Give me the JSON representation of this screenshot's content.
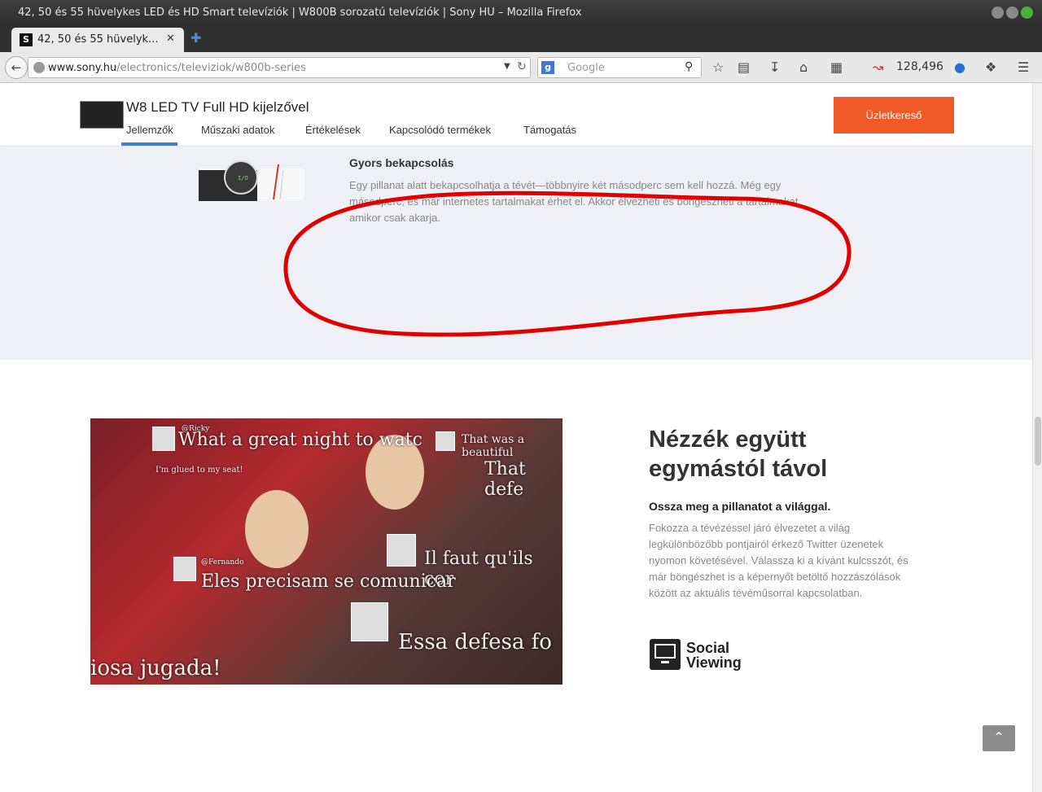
{
  "window": {
    "title": "42, 50 és 55 hüvelykes LED és HD Smart televíziók | W800B sorozatú televíziók | Sony HU – Mozilla Firefox"
  },
  "tab": {
    "favicon": "S",
    "label": "42, 50 és 55 hüvelyk...",
    "close": "✕",
    "new_tab": "✚"
  },
  "navbar": {
    "url_domain": "www.sony.hu",
    "url_path": "/electronics/televiziok/w800b-series",
    "search_placeholder": "Google",
    "counter": "128,496"
  },
  "subnav": {
    "product_title": "W8 LED TV Full HD kijelzővel",
    "links": [
      "Jellemzők",
      "Műszaki adatok",
      "Értékelések",
      "Kapcsolódó termékek",
      "Támogatás"
    ],
    "dealer_button": "Üzletkereső"
  },
  "feature": {
    "title": "Gyors bekapcsolás",
    "body": "Egy pillanat alatt bekapcsolhatja a tévét—többnyire két másodperc sem kell hozzá. Még egy másodperc, és már internetes tartalmakat érhet el. Akkor élvezheti és böngészheti a tartalmakat, amikor csak akarja.",
    "annotation_color": "#e00000"
  },
  "social": {
    "photo_overlays": [
      "What a great night to watc",
      "That was a beautiful",
      "That defe",
      "I'm glued to my seat!",
      "Il faut qu'ils cor",
      "Eles precisam se comunicar",
      "Essa defesa fo",
      "iosa jugada!"
    ],
    "photo_names": [
      "@Ricky",
      "@Fernando"
    ],
    "title": "Nézzék együtt egymástól távol",
    "subtitle": "Ossza meg a pillanatot a világgal.",
    "body": "Fokozza a tévézéssel járó élvezetet a világ legkülönbözőbb pontjairól érkező Twitter üzenetek nyomon követésével. Válassza ki a kívánt kulcsszót, és már böngészhet is a képernyőt betöltő hozzászólások között az aktuális tévéműsorral kapcsolatban.",
    "logo_line1": "Social",
    "logo_line2": "Viewing"
  },
  "colors": {
    "accent": "#3a7fd4",
    "dealer": "#f05a28",
    "gray_bg": "#eef0f5"
  },
  "icons": {
    "back": "back-arrow-icon",
    "totop": "chevron-up-icon"
  }
}
